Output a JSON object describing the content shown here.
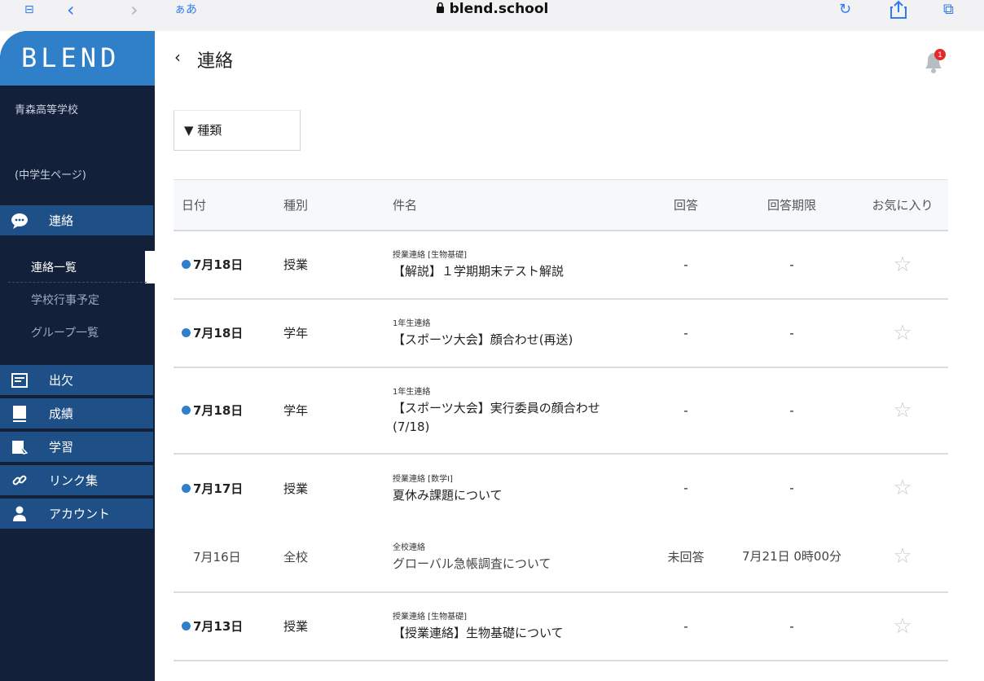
{
  "browser": {
    "text_size": "ぁあ",
    "url": "blend.school",
    "back_glyph": "‹",
    "forward_glyph": "›"
  },
  "sidebar": {
    "logo": "BLEND",
    "school": "青森高等学校",
    "user_page": "(中学生ページ)",
    "nav": [
      {
        "label": "連絡",
        "icon": "chat-icon"
      },
      {
        "label": "出欠",
        "icon": "attendance-icon"
      },
      {
        "label": "成績",
        "icon": "grades-icon"
      },
      {
        "label": "学習",
        "icon": "study-icon"
      },
      {
        "label": "リンク集",
        "icon": "link-icon"
      },
      {
        "label": "アカウント",
        "icon": "account-icon"
      }
    ],
    "sub_items": [
      "連絡一覧",
      "学校行事予定",
      "グループ一覧"
    ]
  },
  "header": {
    "title": "連絡",
    "notification_count": "1"
  },
  "filter": {
    "label": "▼ 種類"
  },
  "table": {
    "columns": [
      "日付",
      "種別",
      "件名",
      "回答",
      "回答期限",
      "お気に入り"
    ],
    "rows": [
      {
        "date": "7月18日",
        "unread": true,
        "category": "授業",
        "sender": "授業連絡 [生物基礎]",
        "subject": "【解説】１学期期末テスト解説",
        "answer": "-",
        "deadline": "-"
      },
      {
        "date": "7月18日",
        "unread": true,
        "category": "学年",
        "sender": "1年生連絡",
        "subject": "【スポーツ大会】顔合わせ(再送)",
        "answer": "-",
        "deadline": "-"
      },
      {
        "date": "7月18日",
        "unread": true,
        "category": "学年",
        "sender": "1年生連絡",
        "subject": "【スポーツ大会】実行委員の顔合わせ(7/18)",
        "answer": "-",
        "deadline": "-"
      },
      {
        "date": "7月17日",
        "unread": true,
        "category": "授業",
        "sender": "授業連絡 [数学Ⅰ]",
        "subject": "夏休み課題について",
        "answer": "-",
        "deadline": "-"
      },
      {
        "date": "7月16日",
        "unread": false,
        "category": "全校",
        "sender": "全校連絡",
        "subject": "グローバル急帳調査について",
        "answer": "未回答",
        "deadline": "7月21日 0時00分"
      },
      {
        "date": "7月13日",
        "unread": true,
        "category": "授業",
        "sender": "授業連絡 [生物基礎]",
        "subject": "【授業連絡】生物基礎について",
        "answer": "-",
        "deadline": "-"
      }
    ]
  }
}
